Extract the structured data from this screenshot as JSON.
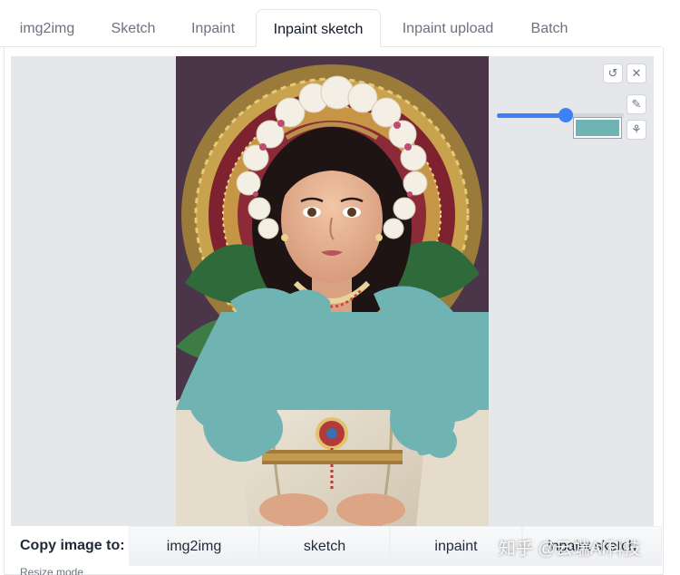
{
  "tabs": [
    "img2img",
    "Sketch",
    "Inpaint",
    "Inpaint sketch",
    "Inpaint upload",
    "Batch"
  ],
  "active_tab": "Inpaint sketch",
  "tools": {
    "undo_icon": "undo-icon",
    "close_icon": "close-icon",
    "brush_icon": "brush-icon",
    "palette_icon": "palette-icon",
    "brush_size": 0.55,
    "brush_color": "#70b3b3"
  },
  "copy_bar": {
    "label": "Copy image to:",
    "buttons": [
      "img2img",
      "sketch",
      "inpaint",
      "inpaint sketch"
    ]
  },
  "resize_mode_label": "Resize mode",
  "watermark": "知乎 @云端AI科技",
  "colors": {
    "mask": "#70b3b3",
    "slider": "#3b82f6"
  }
}
